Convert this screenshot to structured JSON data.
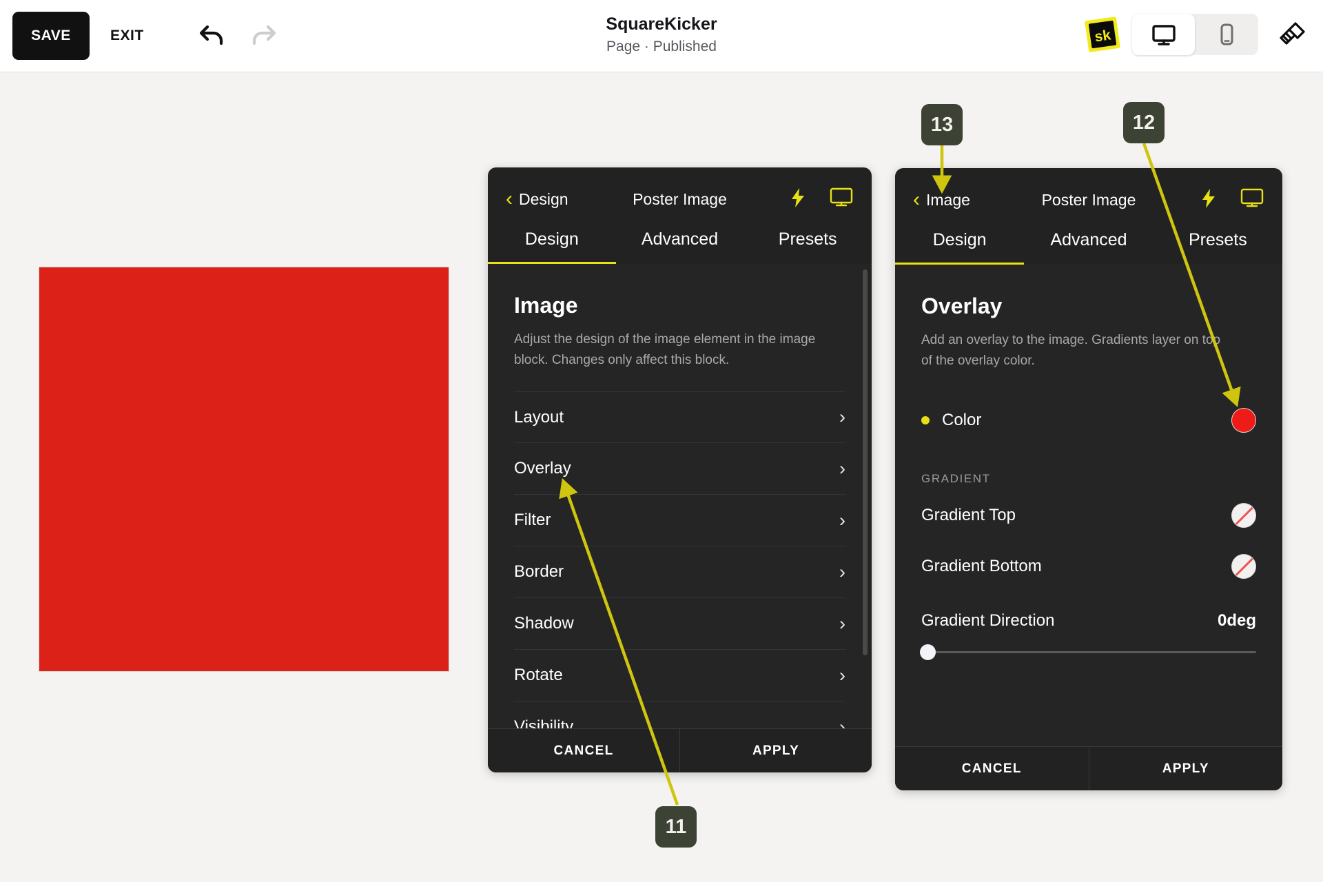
{
  "topbar": {
    "save_label": "SAVE",
    "exit_label": "EXIT",
    "undo_icon": "undo-icon",
    "redo_icon": "redo-icon",
    "title": "SquareKicker",
    "subtitle": "Page · Published",
    "logo_text": "sk",
    "device_desktop_icon": "desktop-icon",
    "device_mobile_icon": "mobile-icon",
    "brush_icon": "paintbrush-icon",
    "active_device": "desktop"
  },
  "canvas": {
    "image_block_color": "#dc2118"
  },
  "panel_left": {
    "back_label": "Design",
    "context_title": "Poster Image",
    "bolt_icon": "lightning-bolt-icon",
    "monitor_icon": "monitor-icon",
    "tabs": [
      {
        "label": "Design",
        "active": true
      },
      {
        "label": "Advanced",
        "active": false
      },
      {
        "label": "Presets",
        "active": false
      }
    ],
    "section_title": "Image",
    "section_desc": "Adjust the design of the image element in the image block. Changes only affect this block.",
    "options": [
      {
        "label": "Layout"
      },
      {
        "label": "Overlay"
      },
      {
        "label": "Filter"
      },
      {
        "label": "Border"
      },
      {
        "label": "Shadow"
      },
      {
        "label": "Rotate"
      },
      {
        "label": "Visibility"
      }
    ],
    "cancel_label": "CANCEL",
    "apply_label": "APPLY"
  },
  "panel_right": {
    "back_label": "Image",
    "context_title": "Poster Image",
    "bolt_icon": "lightning-bolt-icon",
    "monitor_icon": "monitor-icon",
    "tabs": [
      {
        "label": "Design",
        "active": true
      },
      {
        "label": "Advanced",
        "active": false
      },
      {
        "label": "Presets",
        "active": false
      }
    ],
    "section_title": "Overlay",
    "section_desc": "Add an overlay to the image. Gradients layer on top of the overlay color.",
    "color_row": {
      "label": "Color",
      "swatch_color": "#ee1b17",
      "has_value": true
    },
    "gradient_group_label": "GRADIENT",
    "gradient_top": {
      "label": "Gradient Top",
      "swatch_color": "none",
      "has_value": false
    },
    "gradient_bottom": {
      "label": "Gradient Bottom",
      "swatch_color": "none",
      "has_value": false
    },
    "gradient_direction": {
      "label": "Gradient Direction",
      "value": "0deg",
      "percent": 0
    },
    "cancel_label": "CANCEL",
    "apply_label": "APPLY"
  },
  "annotations": {
    "accent_color": "#cfc50f",
    "badges": [
      {
        "id": "11",
        "label": "11"
      },
      {
        "id": "12",
        "label": "12"
      },
      {
        "id": "13",
        "label": "13"
      }
    ]
  }
}
